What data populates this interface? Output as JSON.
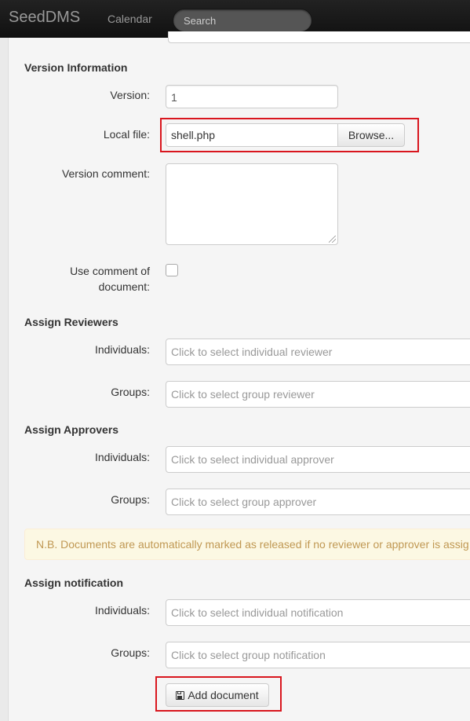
{
  "navbar": {
    "brand": "SeedDMS",
    "calendar_link": "Calendar",
    "search_placeholder": "Search"
  },
  "version_information": {
    "title": "Version Information",
    "version_label": "Version:",
    "version_value": "1",
    "local_file_label": "Local file:",
    "local_file_value": "shell.php",
    "browse_label": "Browse...",
    "version_comment_label": "Version comment:",
    "use_comment_label_line1": "Use comment of",
    "use_comment_label_line2": "document:",
    "use_comment_checked": false
  },
  "assign_reviewers": {
    "title": "Assign Reviewers",
    "individuals_label": "Individuals:",
    "individuals_placeholder": "Click to select individual reviewer",
    "groups_label": "Groups:",
    "groups_placeholder": "Click to select group reviewer"
  },
  "assign_approvers": {
    "title": "Assign Approvers",
    "individuals_label": "Individuals:",
    "individuals_placeholder": "Click to select individual approver",
    "groups_label": "Groups:",
    "groups_placeholder": "Click to select group approver"
  },
  "notice": {
    "text": "N.B. Documents are automatically marked as released if no reviewer or approver is assig"
  },
  "assign_notification": {
    "title": "Assign notification",
    "individuals_label": "Individuals:",
    "individuals_placeholder": "Click to select individual notification",
    "groups_label": "Groups:",
    "groups_placeholder": "Click to select group notification"
  },
  "actions": {
    "add_document_label": "Add document",
    "add_document_icon": "save-icon"
  },
  "colors": {
    "highlight_border": "#d9161e",
    "navbar_bg": "#1b1b1b",
    "notice_text": "#c09853",
    "notice_bg": "#fcf8e3"
  }
}
